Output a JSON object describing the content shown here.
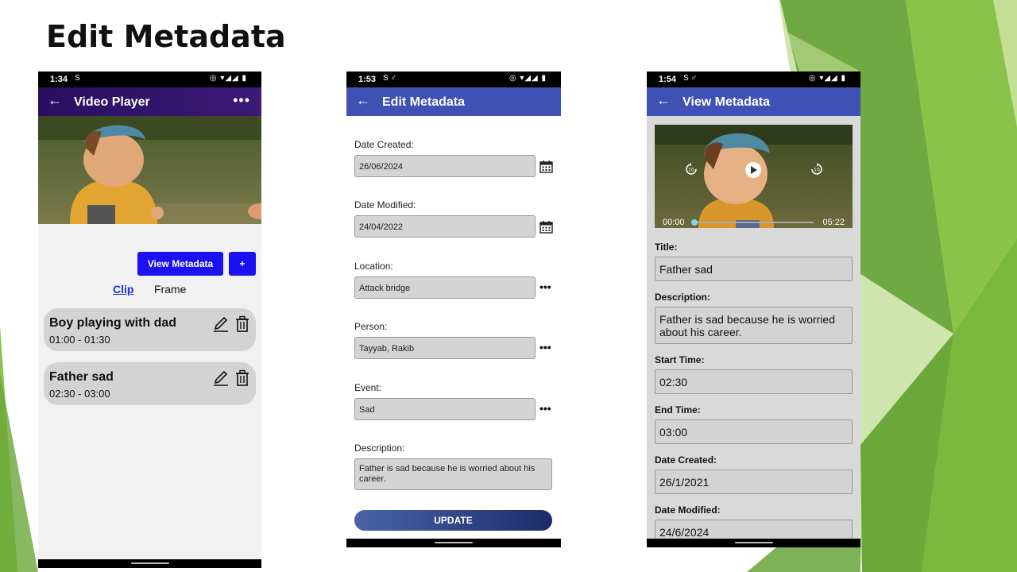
{
  "slide": {
    "title": "Edit Metadata",
    "accent_colors": [
      "#8bc34a",
      "#5f9e2f",
      "#a5d16a"
    ]
  },
  "phone1": {
    "status": {
      "time": "1:34",
      "left_icons": "S",
      "right_icons": "◎ ▾◢◢ ▮"
    },
    "appbar": {
      "back_icon": "←",
      "title": "Video Player",
      "more_icon": "•••",
      "color": "#2a0e5e"
    },
    "buttons": {
      "view_metadata": "View Metadata",
      "add": "+"
    },
    "tabs": {
      "clip": "Clip",
      "frame": "Frame"
    },
    "clips": [
      {
        "title": "Boy playing with dad",
        "time": "01:00 - 01:30"
      },
      {
        "title": "Father sad",
        "time": "02:30 - 03:00"
      }
    ]
  },
  "phone2": {
    "status": {
      "time": "1:53",
      "left_icons": "S ♂",
      "right_icons": "◎ ▾◢◢ ▮"
    },
    "appbar": {
      "back_icon": "←",
      "title": "Edit Metadata",
      "color": "#3f51b5"
    },
    "fields": {
      "date_created": {
        "label": "Date Created:",
        "value": "26/06/2024"
      },
      "date_modified": {
        "label": "Date Modified:",
        "value": "24/04/2022"
      },
      "location": {
        "label": "Location:",
        "value": "Attack bridge"
      },
      "person": {
        "label": "Person:",
        "value": "Tayyab, Rakib"
      },
      "event": {
        "label": "Event:",
        "value": "Sad"
      },
      "description": {
        "label": "Description:",
        "value": "Father is sad because he is worried about his career."
      }
    },
    "more_icon": "•••",
    "update_label": "UPDATE"
  },
  "phone3": {
    "status": {
      "time": "1:54",
      "left_icons": "S ♂",
      "right_icons": "◎ ▾◢◢ ▮"
    },
    "appbar": {
      "back_icon": "←",
      "title": "View Metadata",
      "color": "#3f51b5"
    },
    "video": {
      "current_time": "00:00",
      "duration": "05:22",
      "progress": 0.0
    },
    "fields": {
      "title": {
        "label": "Title:",
        "value": "Father sad"
      },
      "description": {
        "label": "Description:",
        "value": "Father is sad because he is worried about his career."
      },
      "start_time": {
        "label": "Start Time:",
        "value": "02:30"
      },
      "end_time": {
        "label": "End Time:",
        "value": "03:00"
      },
      "date_created": {
        "label": "Date Created:",
        "value": "26/1/2021"
      },
      "date_modified": {
        "label": "Date Modified:",
        "value": "24/6/2024"
      }
    }
  }
}
